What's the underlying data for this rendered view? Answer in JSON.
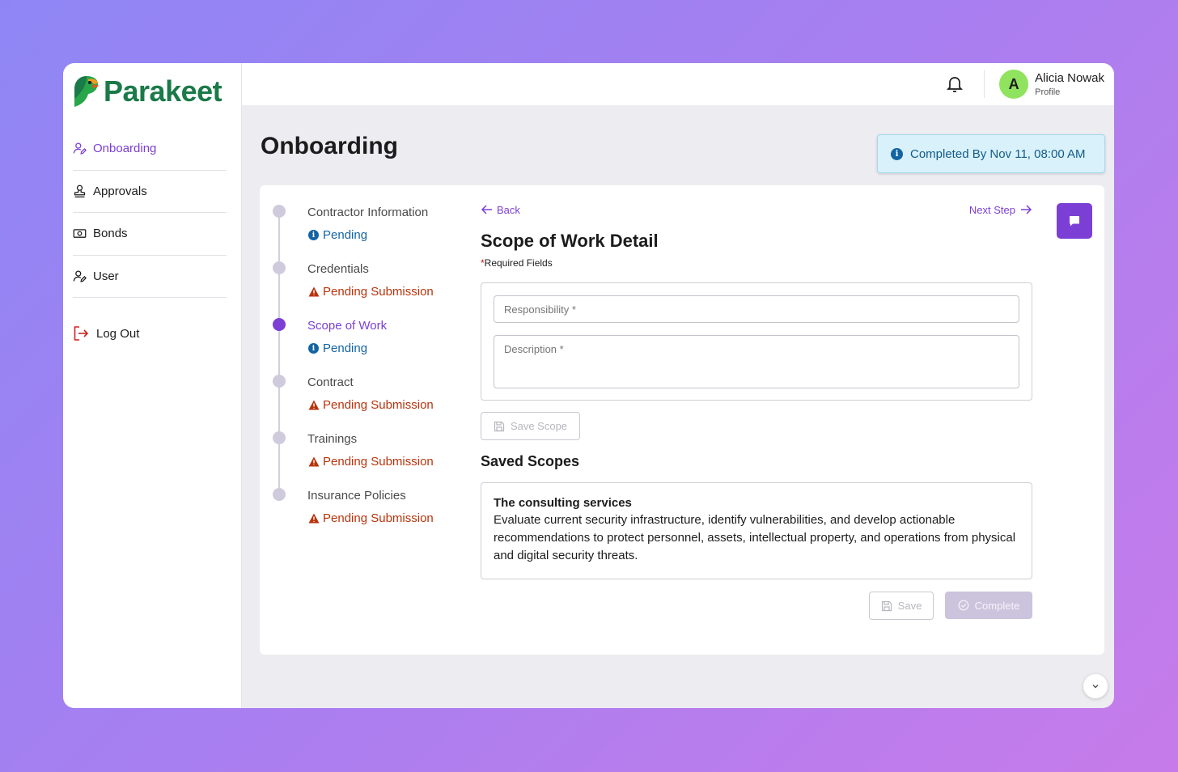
{
  "brand": {
    "name": "Parakeet"
  },
  "sidebar": {
    "items": [
      {
        "label": "Onboarding",
        "icon": "user-edit-icon",
        "active": true
      },
      {
        "label": "Approvals",
        "icon": "stamp-icon",
        "active": false
      },
      {
        "label": "Bonds",
        "icon": "money-icon",
        "active": false
      },
      {
        "label": "User",
        "icon": "user-edit-icon",
        "active": false
      }
    ],
    "logout_label": "Log Out"
  },
  "header": {
    "user_name": "Alicia Nowak",
    "user_sub": "Profile",
    "avatar_initial": "A"
  },
  "page": {
    "title": "Onboarding",
    "deadline": "Completed By Nov 11, 08:00 AM"
  },
  "steps": [
    {
      "title": "Contractor Information",
      "status": "Pending",
      "status_type": "info",
      "current": false
    },
    {
      "title": "Credentials",
      "status": "Pending Submission",
      "status_type": "warning",
      "current": false
    },
    {
      "title": "Scope of Work",
      "status": "Pending",
      "status_type": "info",
      "current": true
    },
    {
      "title": "Contract",
      "status": "Pending Submission",
      "status_type": "warning",
      "current": false
    },
    {
      "title": "Trainings",
      "status": "Pending Submission",
      "status_type": "warning",
      "current": false
    },
    {
      "title": "Insurance Policies",
      "status": "Pending Submission",
      "status_type": "warning",
      "current": false
    }
  ],
  "detail": {
    "back_label": "Back",
    "next_label": "Next Step",
    "title": "Scope of Work Detail",
    "required_star": "*",
    "required_label": "Required Fields",
    "responsibility_placeholder": "Responsibility *",
    "description_placeholder": "Description *",
    "save_scope_label": "Save Scope",
    "saved_title": "Saved Scopes",
    "saved_scopes": [
      {
        "name": "The consulting services",
        "description": "Evaluate current security infrastructure, identify vulnerabilities, and develop actionable recommendations to protect personnel, assets, intellectual property, and operations from physical and digital security threats."
      }
    ],
    "save_label": "Save",
    "complete_label": "Complete"
  },
  "colors": {
    "accent": "#7b3fd6",
    "brand_green": "#1a7a48",
    "info_blue": "#1264a3",
    "warning_red": "#b8340c"
  }
}
